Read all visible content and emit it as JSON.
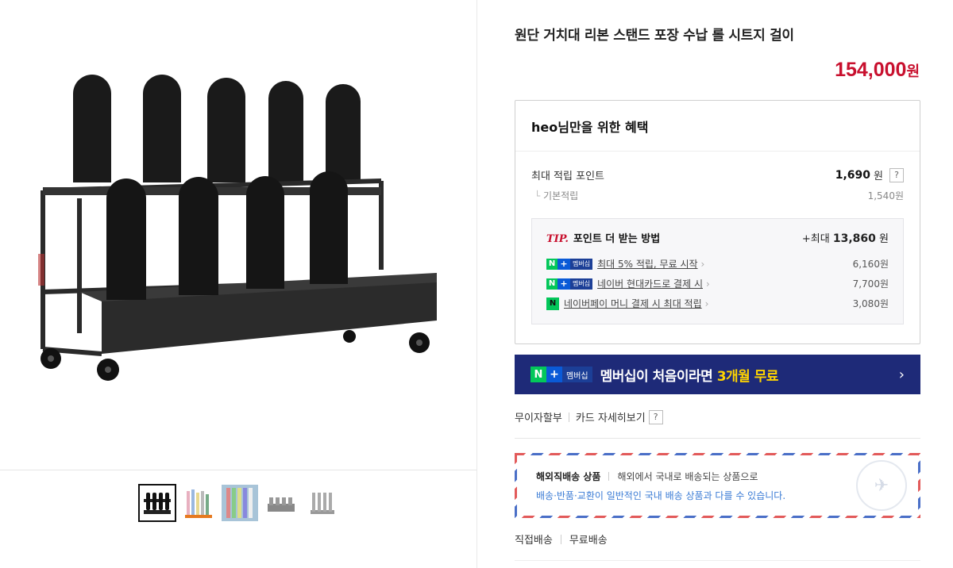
{
  "product": {
    "title": "원단 거치대 리본 스탠드 포장 수납 롤 시트지 걸이",
    "price": "154,000",
    "price_unit": "원"
  },
  "gallery": {
    "main_image": "black-fabric-roll-rack-image",
    "thumbnails": [
      {
        "name": "thumb-black-rack",
        "active": true
      },
      {
        "name": "thumb-colored-rolls",
        "active": false
      },
      {
        "name": "thumb-rolls-display",
        "active": false
      },
      {
        "name": "thumb-grey-rack",
        "active": false
      },
      {
        "name": "thumb-grey-rack-tall",
        "active": false
      }
    ]
  },
  "benefit": {
    "header": "heo님만을 위한 혜택",
    "max_point_label": "최대 적립 포인트",
    "max_point_value": "1,690",
    "won": "원",
    "help_mark": "?",
    "base_label": "기본적립",
    "base_value": "1,540원",
    "tip": {
      "tip_mark": "TIP.",
      "label": "포인트 더 받는 방법",
      "max_prefix": "+최대",
      "max_value": "13,860",
      "max_unit": "원",
      "rows": [
        {
          "text": "최대 5% 적립, 무료 시작",
          "amount": "6,160원",
          "badge": "n-plus-membership"
        },
        {
          "text": "네이버 현대카드로 결제 시",
          "amount": "7,700원",
          "badge": "n-plus-membership"
        },
        {
          "text": "네이버페이 머니 결제 시 최대 적립",
          "amount": "3,080원",
          "badge": "naverpay"
        }
      ]
    }
  },
  "badges": {
    "n": "N",
    "plus": "+",
    "membership": "멤버십",
    "npay": "N"
  },
  "banner": {
    "text_before": "멤버십이 처음이라면 ",
    "text_highlight": "3개월 무료",
    "arrow": "›"
  },
  "cardinfo": {
    "installment": "무이자할부",
    "card_detail": "카드 자세히보기",
    "help_mark": "?"
  },
  "intl": {
    "title": "해외직배송 상품",
    "desc": "해외에서 국내로 배송되는 상품으로",
    "notice": "배송·반품·교환이 일반적인 국내 배송 상품과 다를 수 있습니다."
  },
  "shipping": {
    "method": "직접배송",
    "fee": "무료배송"
  },
  "colors": {
    "price_red": "#c8102e",
    "banner_navy": "#1e2a78",
    "highlight_yellow": "#ffd400",
    "naver_green": "#03c75a"
  }
}
